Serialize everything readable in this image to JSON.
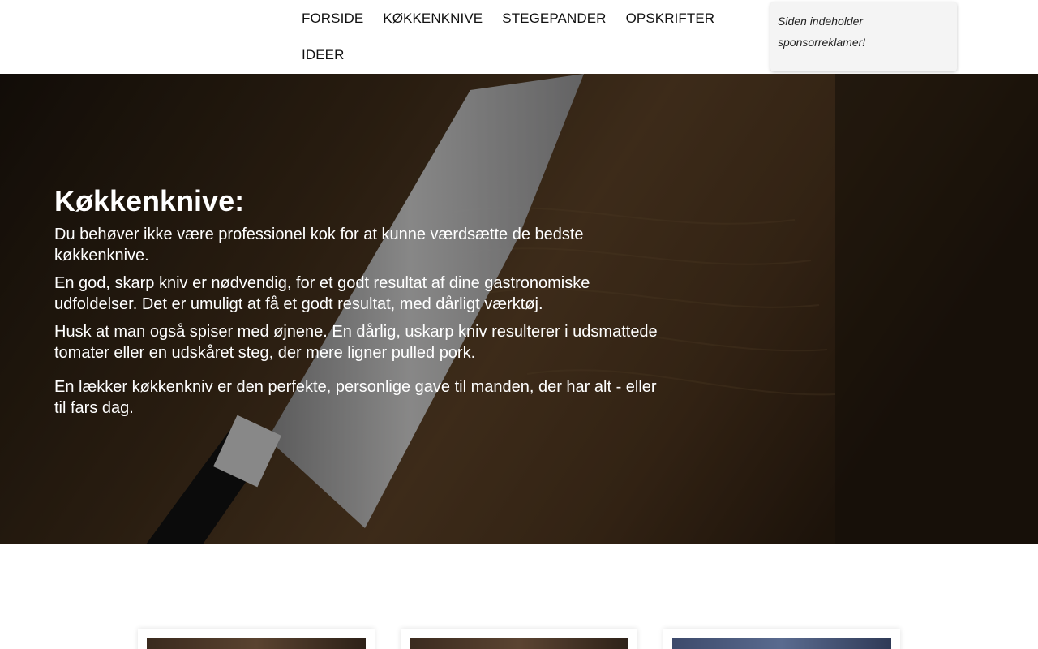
{
  "nav": {
    "items": [
      "FORSIDE",
      "KØKKENKNIVE",
      "STEGEPANDER",
      "OPSKRIFTER",
      "IDEER"
    ]
  },
  "sponsor": {
    "text_line1": "Siden indeholder",
    "text_line2": "sponsorreklamer!"
  },
  "hero": {
    "title": "Køkkenknive:",
    "paragraphs": [
      "Du behøver ikke være professionel kok for at kunne værdsætte de bedste køkkenknive.",
      "En god, skarp kniv er nødvendig, for et godt resultat af dine gastronomiske udfoldelser. Det er umuligt at få et godt resultat, med dårligt værktøj.",
      "Husk at man også spiser med øjnene. En dårlig, uskarp kniv resulterer i udsmattede tomater eller en udskåret steg, der mere ligner pulled pork.",
      "En lækker køkkenkniv er den perfekte, personlige gave til manden, der har alt - eller til fars dag."
    ]
  },
  "colors": {
    "hero_text": "#ffffff",
    "nav_text": "#111111",
    "sponsor_bg": "#f4f4f4"
  }
}
